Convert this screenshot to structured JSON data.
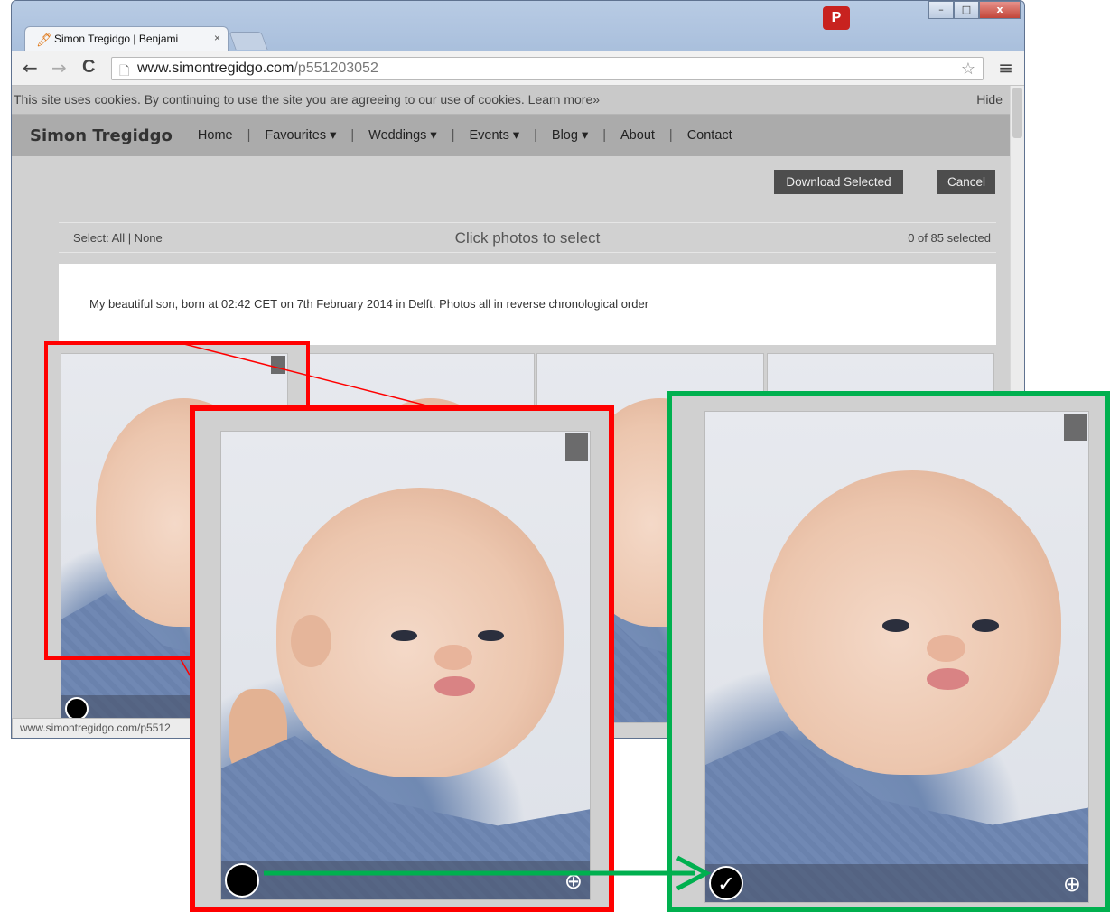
{
  "browser": {
    "tab_title": "Simon Tregidgo | Benjami",
    "tab_close": "×",
    "url_domain": "www.simontregidgo.com",
    "url_path": "/p551203052",
    "extension_badge": "P",
    "status_url": "www.simontregidgo.com/p5512"
  },
  "cookie_bar": {
    "text": "This site uses cookies. By continuing to use the site you are agreeing to our use of cookies. Learn more»",
    "hide": "Hide"
  },
  "site_nav": {
    "brand": "Simon Tregidgo",
    "items": [
      "Home",
      "Favourites ▾",
      "Weddings ▾",
      "Events ▾",
      "Blog ▾",
      "About",
      "Contact"
    ],
    "separator": "|"
  },
  "actions": {
    "download_selected": "Download Selected",
    "cancel": "Cancel"
  },
  "selection_bar": {
    "select_label": "Select: All | None",
    "instruction": "Click photos to select",
    "count": "0 of 85 selected"
  },
  "gallery_description": "My beautiful son, born at 02:42 CET on 7th February 2014 in Delft. Photos all in reverse chronological order",
  "colors": {
    "callout_before": "#ff0000",
    "callout_after": "#00b04f",
    "button_bg": "#4d4d4d",
    "nav_bg": "#ababab"
  },
  "icons": {
    "back": "←",
    "forward": "→",
    "reload": "C",
    "star": "☆",
    "menu": "≡",
    "check": "✓",
    "zoom": "⊕"
  }
}
